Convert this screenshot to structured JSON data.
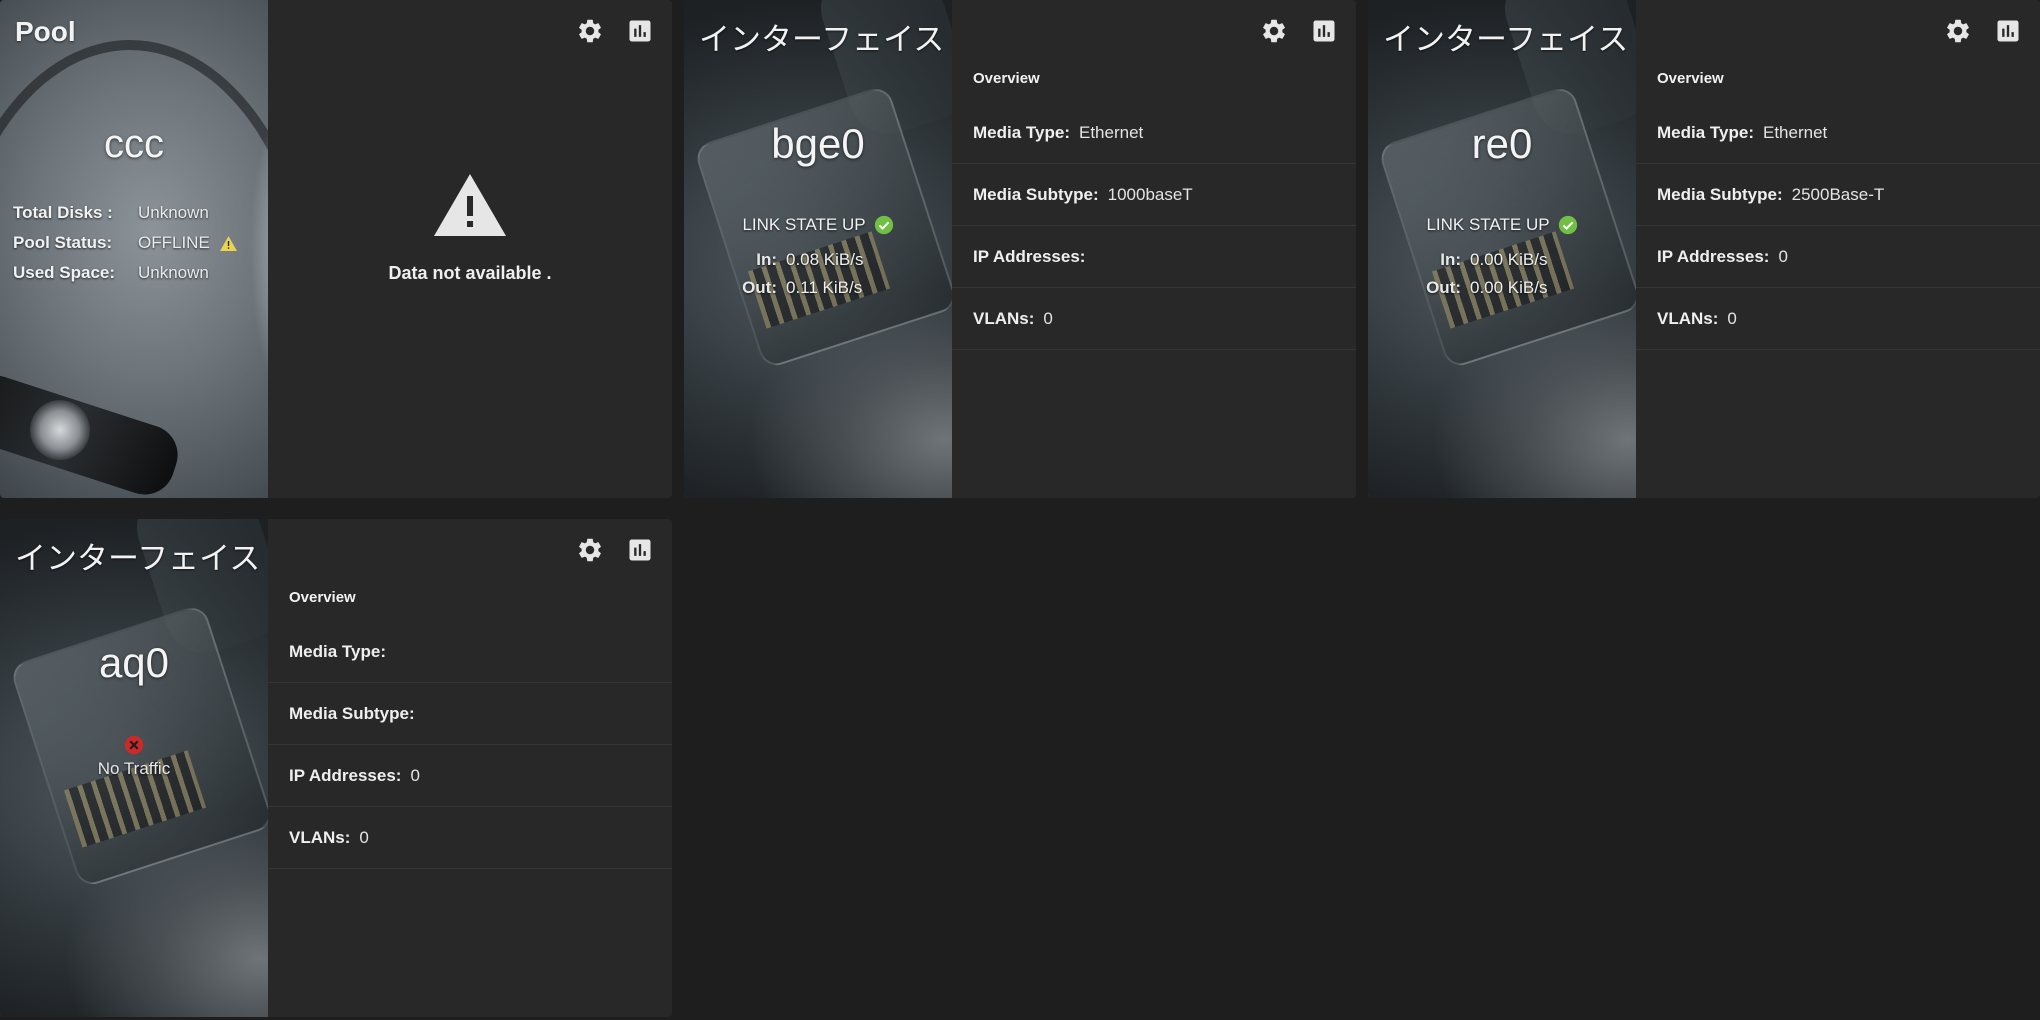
{
  "pool": {
    "title": "Pool",
    "name": "ccc",
    "stats": [
      {
        "label": "Total Disks :",
        "value": "Unknown"
      },
      {
        "label": "Pool Status:",
        "value": "OFFLINE"
      },
      {
        "label": "Used Space:",
        "value": "Unknown"
      }
    ],
    "status_icon": "warning-icon",
    "not_available_text": "Data not available .",
    "warning_color": "#e8d44d"
  },
  "interfaces": [
    {
      "title": "インターフェイス",
      "name": "bge0",
      "link_state": "LINK STATE UP",
      "in_label": "In:",
      "in_value": "0.08 KiB/s",
      "out_label": "Out:",
      "out_value": "0.11 KiB/s",
      "overview_label": "Overview",
      "media_type_label": "Media Type:",
      "media_type": "Ethernet",
      "media_subtype_label": "Media Subtype:",
      "media_subtype": "1000baseT",
      "ip_label": "IP Addresses:",
      "ip_value": "",
      "vlans_label": "VLANs:",
      "vlans_value": "0"
    },
    {
      "title": "インターフェイス",
      "name": "re0",
      "link_state": "LINK STATE UP",
      "in_label": "In:",
      "in_value": "0.00 KiB/s",
      "out_label": "Out:",
      "out_value": "0.00 KiB/s",
      "overview_label": "Overview",
      "media_type_label": "Media Type:",
      "media_type": "Ethernet",
      "media_subtype_label": "Media Subtype:",
      "media_subtype": "2500Base-T",
      "ip_label": "IP Addresses:",
      "ip_value": "0",
      "vlans_label": "VLANs:",
      "vlans_value": "0"
    },
    {
      "title": "インターフェイス",
      "name": "aq0",
      "status_text": "No Traffic",
      "overview_label": "Overview",
      "media_type_label": "Media Type:",
      "media_type": "",
      "media_subtype_label": "Media Subtype:",
      "media_subtype": "",
      "ip_label": "IP Addresses:",
      "ip_value": "0",
      "vlans_label": "VLANs:",
      "vlans_value": "0"
    }
  ],
  "icons": {
    "settings": "gear-icon",
    "reports": "bar-chart-icon",
    "link_up": "check-circle-icon",
    "no_traffic": "error-circle-icon"
  },
  "colors": {
    "ok_green": "#71bf44",
    "error_red": "#ce2929",
    "card_bg": "#282828",
    "page_bg": "#1e1e1e"
  }
}
